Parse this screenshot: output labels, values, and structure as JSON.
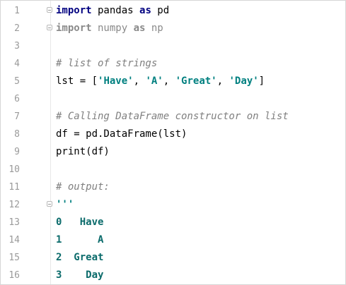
{
  "editor": {
    "lines": [
      {
        "n": "1"
      },
      {
        "n": "2"
      },
      {
        "n": "3"
      },
      {
        "n": "4"
      },
      {
        "n": "5"
      },
      {
        "n": "6"
      },
      {
        "n": "7"
      },
      {
        "n": "8"
      },
      {
        "n": "9"
      },
      {
        "n": "10"
      },
      {
        "n": "11"
      },
      {
        "n": "12"
      },
      {
        "n": "13"
      },
      {
        "n": "14"
      },
      {
        "n": "15"
      },
      {
        "n": "16"
      }
    ],
    "code": {
      "l1": {
        "kw1": "import",
        "mod": " pandas ",
        "kw2": "as",
        "alias": " pd"
      },
      "l2": {
        "kw1": "import",
        "mod": " numpy ",
        "kw2": "as",
        "alias": " np"
      },
      "l4": {
        "comment": "# list of strings"
      },
      "l5": {
        "pre": "lst = [",
        "s1": "'Have'",
        "c1": ", ",
        "s2": "'A'",
        "c2": ", ",
        "s3": "'Great'",
        "c3": ", ",
        "s4": "'Day'",
        "post": "]"
      },
      "l7": {
        "comment": "# Calling DataFrame constructor on list"
      },
      "l8": {
        "text": "df = pd.DataFrame(lst)"
      },
      "l9": {
        "text": "print(df)"
      },
      "l11": {
        "comment": "# output:"
      },
      "l12": {
        "text": "'''"
      },
      "l13": {
        "idx": "0",
        "val": "   Have"
      },
      "l14": {
        "idx": "1",
        "val": "      A"
      },
      "l15": {
        "idx": "2",
        "val": "  Great"
      },
      "l16": {
        "idx": "3",
        "val": "    Day"
      }
    }
  }
}
